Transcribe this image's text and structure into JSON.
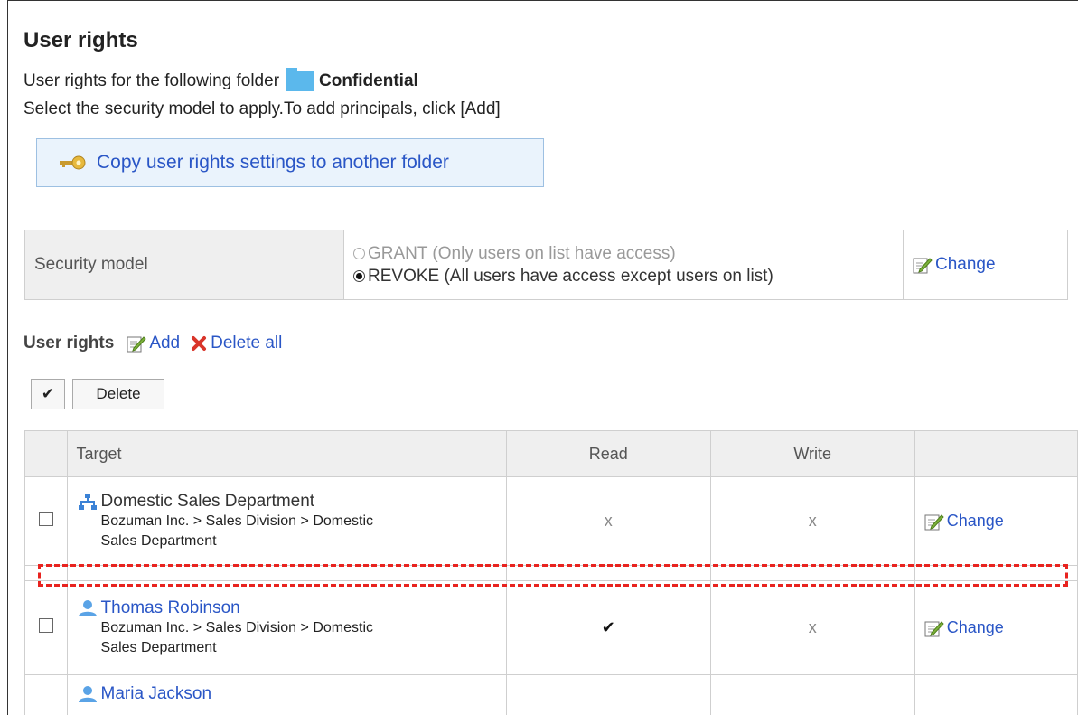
{
  "page": {
    "title": "User rights",
    "folder_line_prefix": "User rights for the following folder",
    "folder_name": "Confidential",
    "instruction": "Select the security model to apply.To add principals, click [Add]",
    "copy_button_label": "Copy user rights settings to another folder"
  },
  "security_model": {
    "label": "Security model",
    "options": [
      {
        "label": "GRANT (Only users on list have access)",
        "selected": false
      },
      {
        "label": "REVOKE (All users have access except users on list)",
        "selected": true
      }
    ],
    "change_label": "Change"
  },
  "user_rights": {
    "heading": "User rights",
    "add_label": "Add",
    "delete_all_label": "Delete all",
    "toggle_check_label": "✔",
    "delete_button_label": "Delete",
    "columns": {
      "target": "Target",
      "read": "Read",
      "write": "Write"
    },
    "rows": [
      {
        "type": "organization",
        "name": "Domestic Sales Department",
        "path1": "Bozuman Inc. > Sales Division > Domestic",
        "path2": "Sales Department",
        "read": "x",
        "write": "x",
        "action": "Change"
      },
      {
        "type": "user",
        "name": "Thomas Robinson",
        "path1": "Bozuman Inc. > Sales Division > Domestic",
        "path2": "Sales Department",
        "read": "✔",
        "write": "x",
        "action": "Change"
      },
      {
        "type": "user",
        "name": "Maria Jackson"
      }
    ]
  },
  "colors": {
    "link": "#2a56c6",
    "highlight": "#e8231f",
    "header_bg": "#efefef",
    "copy_button_bg": "#eaf3fc"
  }
}
